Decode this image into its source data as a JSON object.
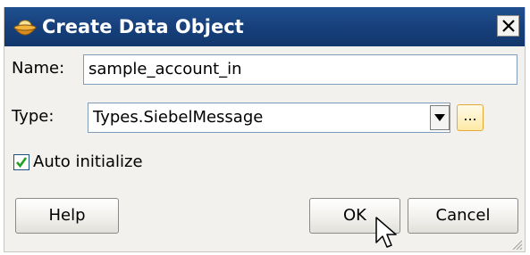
{
  "dialog": {
    "title": "Create Data Object",
    "title_icon": "bowl-icon",
    "close_icon": "close-icon"
  },
  "form": {
    "name_label": "Name:",
    "name_value": "sample_account_in",
    "type_label": "Type:",
    "type_value": "Types.SiebelMessage",
    "browse_label": "...",
    "auto_init_label": "Auto initialize",
    "auto_init_checked": true
  },
  "buttons": {
    "help": "Help",
    "ok": "OK",
    "cancel": "Cancel"
  },
  "colors": {
    "titlebar": "#163f7a",
    "body": "#f2f1ed",
    "field_border": "#7f9db9",
    "checkbox_check": "#21a121",
    "browse_border": "#e5a83a"
  }
}
